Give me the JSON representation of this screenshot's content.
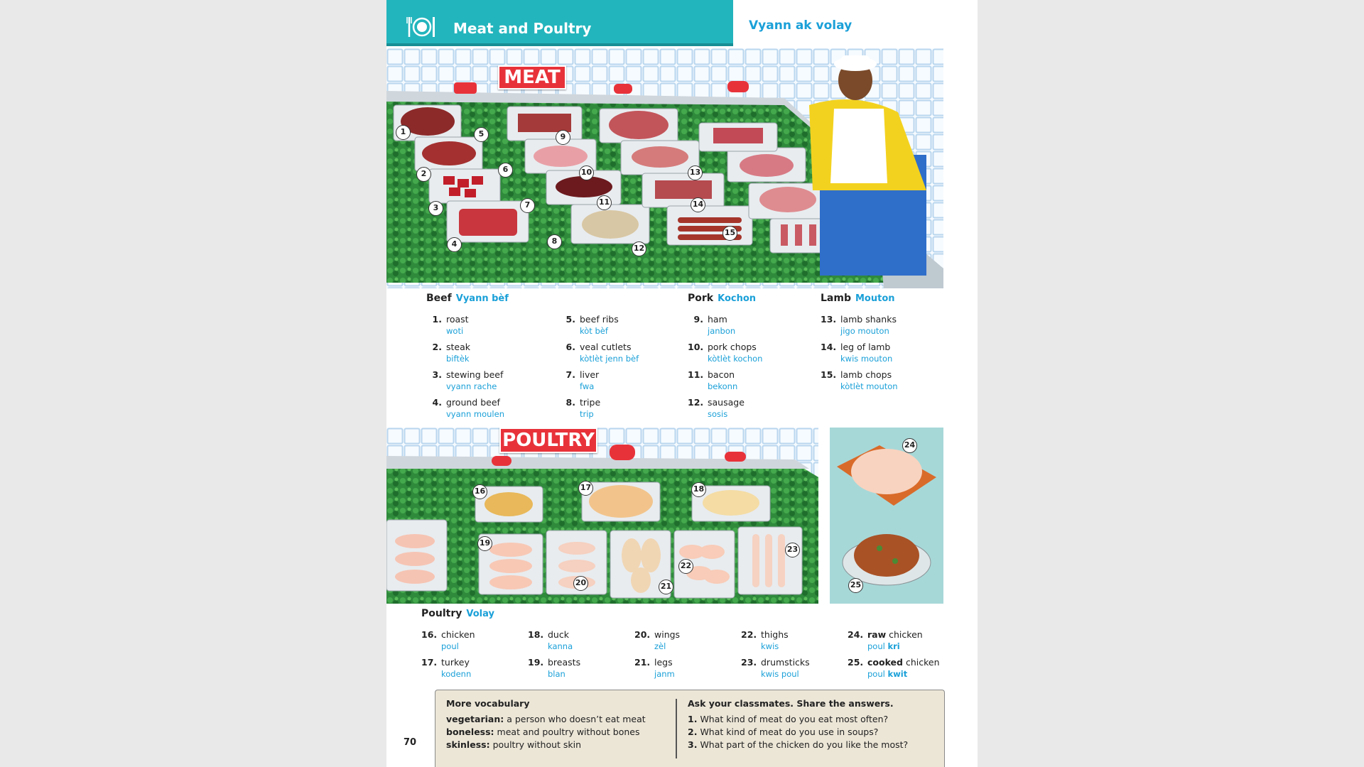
{
  "header": {
    "title": "Meat and Poultry",
    "subtitle": "Vyann ak volay",
    "icon": "plate-fork-icon",
    "accent_color": "#23b5bd",
    "kreyol_color": "#1aa0d8"
  },
  "signs": {
    "meat": "MEAT",
    "poultry": "POULTRY"
  },
  "beef": {
    "label": "Beef",
    "label_kr": "Vyann bèf",
    "items": [
      {
        "n": "1.",
        "en": "roast",
        "kr": "woti"
      },
      {
        "n": "2.",
        "en": "steak",
        "kr": "biftèk"
      },
      {
        "n": "3.",
        "en": "stewing beef",
        "kr": "vyann rache"
      },
      {
        "n": "4.",
        "en": "ground beef",
        "kr": "vyann moulen"
      },
      {
        "n": "5.",
        "en": "beef ribs",
        "kr": "kòt bèf"
      },
      {
        "n": "6.",
        "en": "veal cutlets",
        "kr": "kòtlèt jenn bèf"
      },
      {
        "n": "7.",
        "en": "liver",
        "kr": "fwa"
      },
      {
        "n": "8.",
        "en": "tripe",
        "kr": "trip"
      }
    ]
  },
  "pork": {
    "label": "Pork",
    "label_kr": "Kochon",
    "items": [
      {
        "n": "9.",
        "en": "ham",
        "kr": "janbon"
      },
      {
        "n": "10.",
        "en": "pork chops",
        "kr": "kòtlèt kochon"
      },
      {
        "n": "11.",
        "en": "bacon",
        "kr": "bekonn"
      },
      {
        "n": "12.",
        "en": "sausage",
        "kr": "sosis"
      }
    ]
  },
  "lamb": {
    "label": "Lamb",
    "label_kr": "Mouton",
    "items": [
      {
        "n": "13.",
        "en": "lamb shanks",
        "kr": "jigo mouton"
      },
      {
        "n": "14.",
        "en": "leg of lamb",
        "kr": "kwis mouton"
      },
      {
        "n": "15.",
        "en": "lamb chops",
        "kr": "kòtlèt mouton"
      }
    ]
  },
  "poultry": {
    "label": "Poultry",
    "label_kr": "Volay",
    "items": [
      {
        "n": "16.",
        "en": "chicken",
        "kr": "poul"
      },
      {
        "n": "17.",
        "en": "turkey",
        "kr": "kodenn"
      },
      {
        "n": "18.",
        "en": "duck",
        "kr": "kanna"
      },
      {
        "n": "19.",
        "en": "breasts",
        "kr": "blan"
      },
      {
        "n": "20.",
        "en": "wings",
        "kr": "zèl"
      },
      {
        "n": "21.",
        "en": "legs",
        "kr": "janm"
      },
      {
        "n": "22.",
        "en": "thighs",
        "kr": "kwis"
      },
      {
        "n": "23.",
        "en": "drumsticks",
        "kr": "kwis poul"
      },
      {
        "n": "24.",
        "en_bold": "raw",
        "en": " chicken",
        "kr": "poul ",
        "kr_bold": "kri"
      },
      {
        "n": "25.",
        "en_bold": "cooked",
        "en": " chicken",
        "kr": "poul ",
        "kr_bold": "kwit"
      }
    ]
  },
  "callouts": [
    "1",
    "2",
    "3",
    "4",
    "5",
    "6",
    "7",
    "8",
    "9",
    "10",
    "11",
    "12",
    "13",
    "14",
    "15",
    "16",
    "17",
    "18",
    "19",
    "20",
    "21",
    "22",
    "23",
    "24",
    "25"
  ],
  "more_vocabulary": {
    "title": "More vocabulary",
    "entries": [
      {
        "term": "vegetarian:",
        "def": " a person who doesn’t eat meat"
      },
      {
        "term": "boneless:",
        "def": " meat and poultry without bones"
      },
      {
        "term": "skinless:",
        "def": " poultry without skin"
      }
    ]
  },
  "classmates": {
    "title": "Ask your classmates. Share the answers.",
    "questions": [
      {
        "n": "1.",
        "q": "What kind of meat do you eat most often?"
      },
      {
        "n": "2.",
        "q": "What kind of meat do you use in soups?"
      },
      {
        "n": "3.",
        "q": "What part of the chicken do you like the most?"
      }
    ]
  },
  "page_number": "70"
}
